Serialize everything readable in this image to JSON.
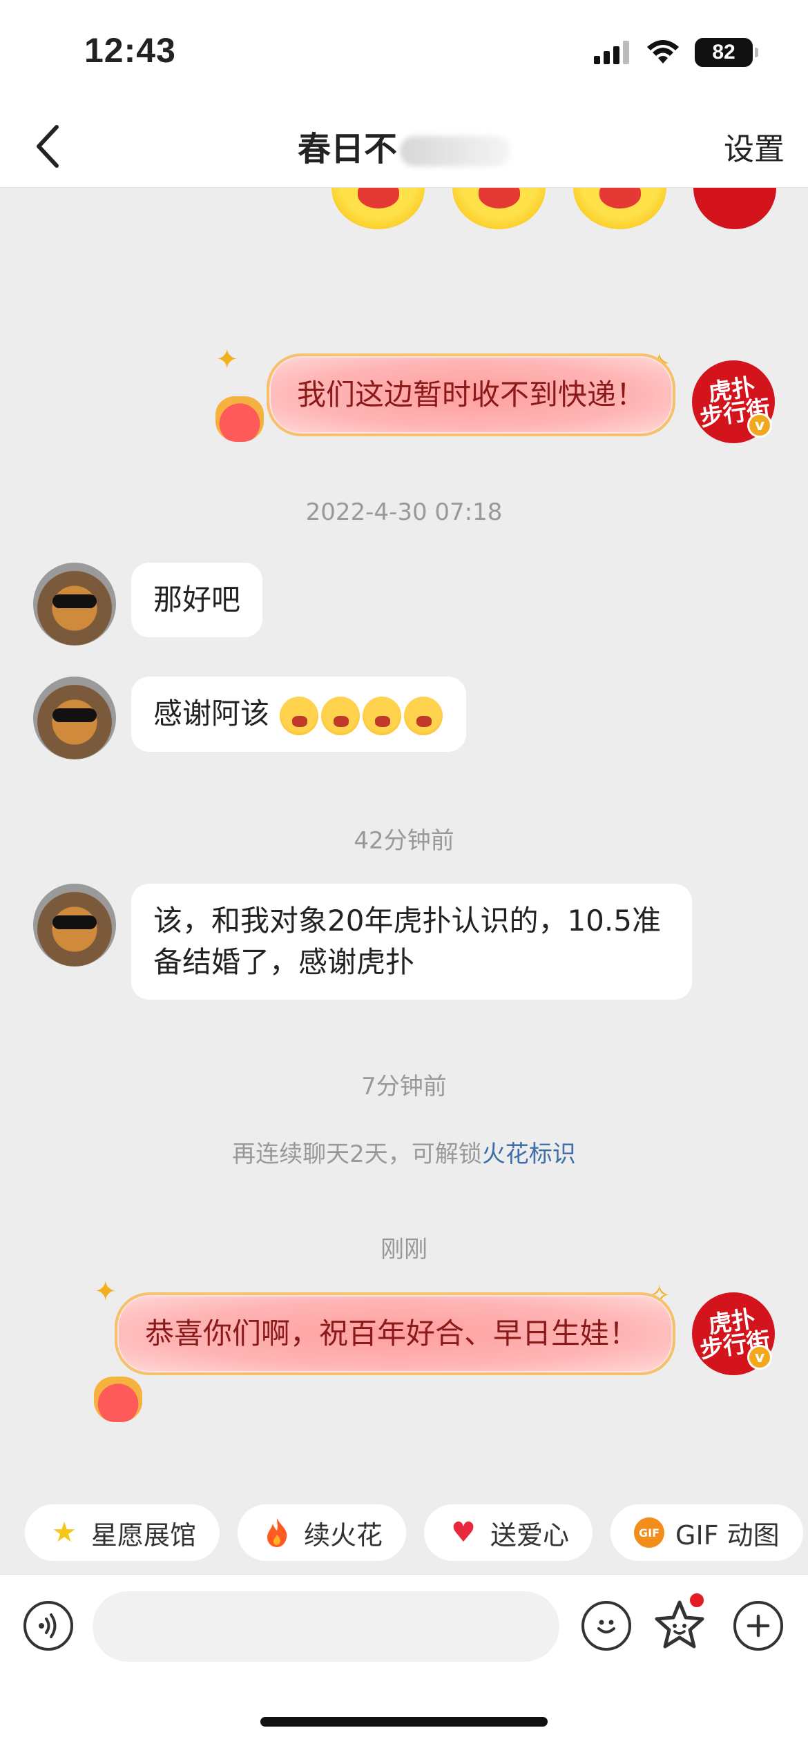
{
  "status_bar": {
    "time": "12:43",
    "battery": "82"
  },
  "nav": {
    "title": "春日不",
    "settings_label": "设置"
  },
  "brand_avatar": {
    "line1": "虎扑",
    "line2": "步行街",
    "badge": "v"
  },
  "messages": [
    {
      "side": "right",
      "text": "我们这边暂时收不到快递！"
    },
    {
      "timestamp": "2022-4-30 07:18"
    },
    {
      "side": "left",
      "text": "那好吧"
    },
    {
      "side": "left",
      "text": "感谢阿该"
    },
    {
      "timestamp": "42分钟前"
    },
    {
      "side": "left",
      "text": "该，和我对象20年虎扑认识的，10.5准备结婚了，感谢虎扑"
    },
    {
      "timestamp": "7分钟前"
    },
    {
      "notice": "再连续聊天2天，可解锁",
      "notice_link": "火花标识"
    },
    {
      "timestamp": "刚刚"
    },
    {
      "side": "right",
      "text": "恭喜你们啊，祝百年好合、早日生娃！"
    }
  ],
  "quick_actions": [
    {
      "label": "星愿展馆",
      "icon": "star-icon"
    },
    {
      "label": "续火花",
      "icon": "fire-icon"
    },
    {
      "label": "送爱心",
      "icon": "heart-icon"
    },
    {
      "label": "GIF 动图",
      "icon": "gif-icon",
      "icon_text": "GIF"
    }
  ],
  "input": {
    "placeholder": ""
  },
  "colors": {
    "accent_red": "#d3141c",
    "link_blue": "#3f6ea8",
    "bubble_border": "#f7c06a"
  }
}
